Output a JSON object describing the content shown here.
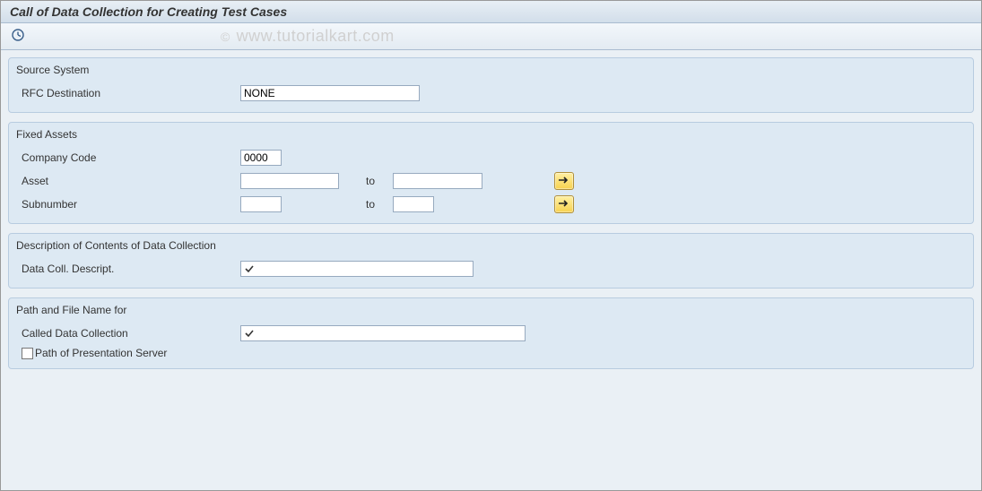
{
  "title": "Call of Data Collection for Creating Test Cases",
  "watermark": {
    "copy": "©",
    "text": "www.tutorialkart.com"
  },
  "groups": {
    "source_system": {
      "legend": "Source System",
      "rfc_destination_label": "RFC Destination",
      "rfc_destination_value": "NONE"
    },
    "fixed_assets": {
      "legend": "Fixed Assets",
      "company_code_label": "Company Code",
      "company_code_value": "0000",
      "asset_label": "Asset",
      "asset_from": "",
      "asset_to_label": "to",
      "asset_to": "",
      "subnumber_label": "Subnumber",
      "subnumber_from": "",
      "subnumber_to_label": "to",
      "subnumber_to": ""
    },
    "description": {
      "legend": "Description of Contents of Data Collection",
      "desc_label": "Data Coll. Descript.",
      "desc_value": ""
    },
    "path": {
      "legend": "Path and File Name for",
      "called_label": "Called Data Collection",
      "called_value": "",
      "presentation_label": "Path of Presentation Server",
      "presentation_checked": false
    }
  }
}
